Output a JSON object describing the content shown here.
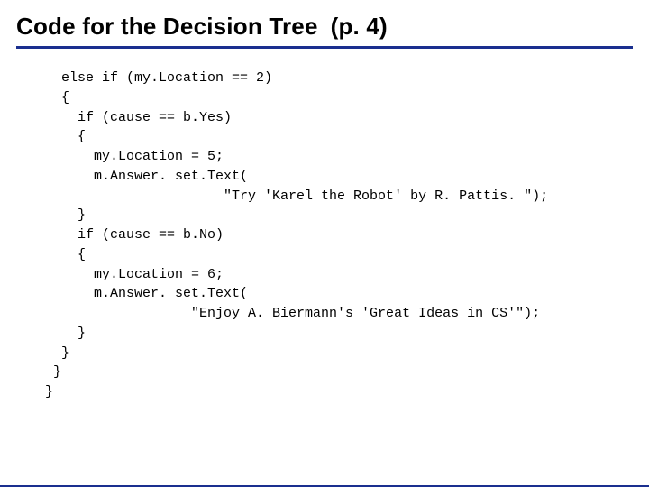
{
  "title": {
    "main": "Code for the Decision Tree",
    "secondary": "(p. 4)"
  },
  "code": "  else if (my.Location == 2)\n  {\n    if (cause == b.Yes)\n    {\n      my.Location = 5;\n      m.Answer. set.Text(\n                      \"Try 'Karel the Robot' by R. Pattis. \");\n    }\n    if (cause == b.No)\n    {\n      my.Location = 6;\n      m.Answer. set.Text(\n                  \"Enjoy A. Biermann's 'Great Ideas in CS'\");\n    }\n  }\n }\n}"
}
